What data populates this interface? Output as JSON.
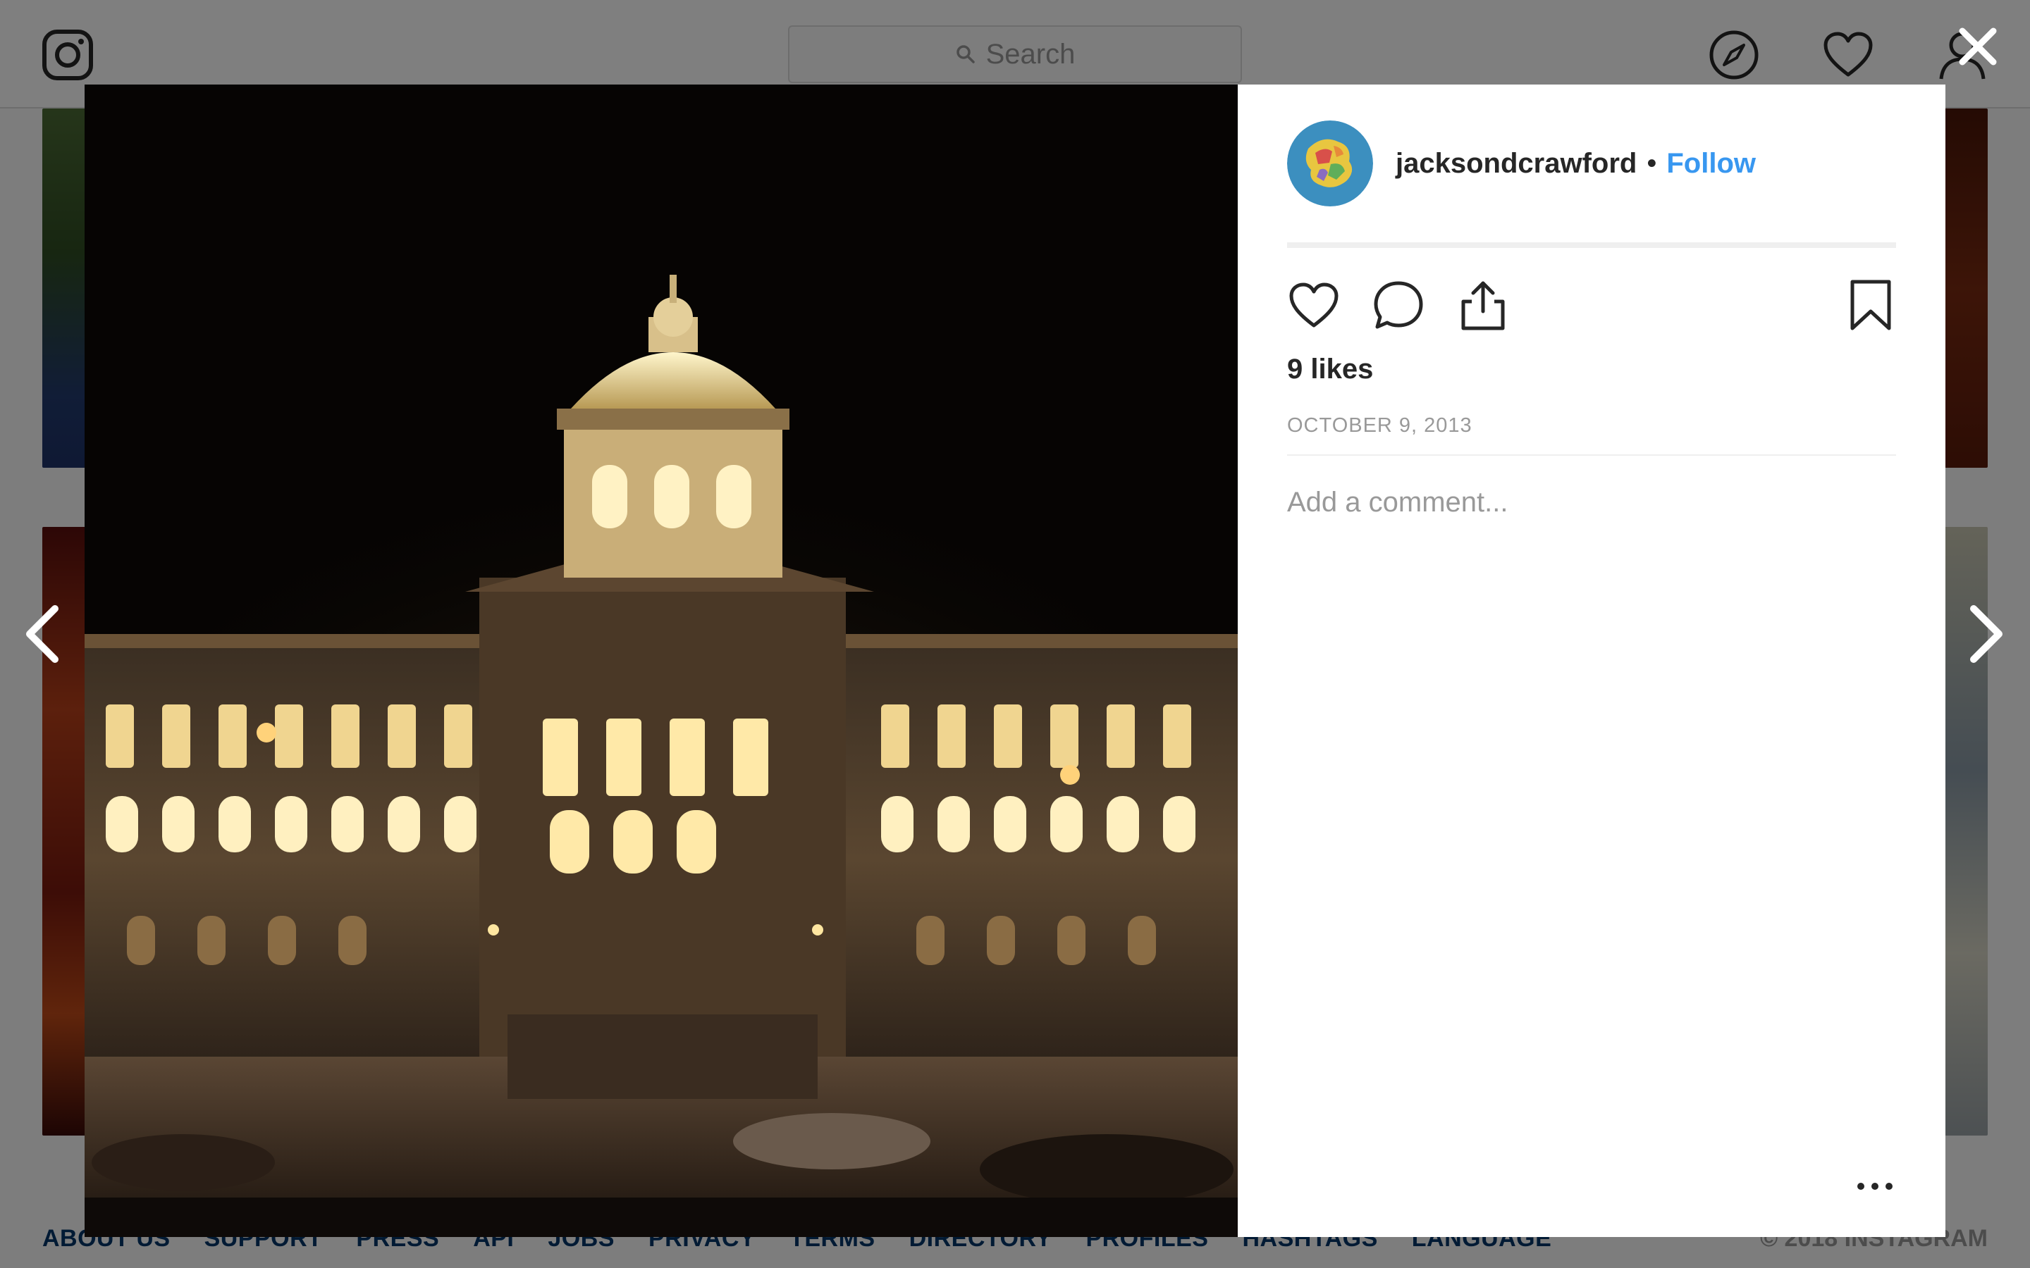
{
  "nav": {
    "search_placeholder": "Search",
    "icons": [
      "instagram-icon",
      "search-icon",
      "explore-compass-icon",
      "activity-heart-icon",
      "profile-icon"
    ]
  },
  "footer": {
    "links": [
      "About us",
      "Support",
      "Press",
      "API",
      "Jobs",
      "Privacy",
      "Terms",
      "Directory",
      "Profiles",
      "Hashtags",
      "Language"
    ],
    "copyright": "© 2018 Instagram"
  },
  "post": {
    "username": "jacksondcrawford",
    "separator": "•",
    "follow_label": "Follow",
    "likes": "9 likes",
    "date": "October 9, 2013",
    "comment_placeholder": "Add a comment..."
  },
  "colors": {
    "link_blue": "#3897f0",
    "text_dark": "#262626",
    "text_muted": "#999999",
    "divider": "#efefef",
    "overlay": "rgba(0,0,0,0.5)"
  }
}
